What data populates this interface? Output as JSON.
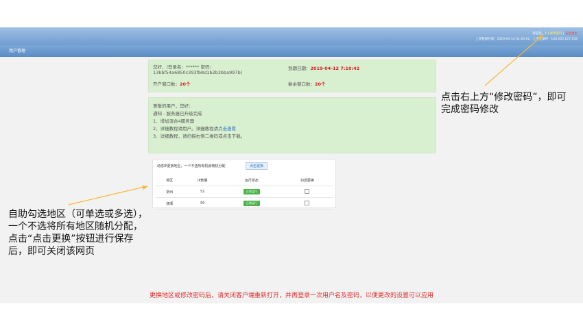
{
  "header": {
    "welcome_prefix": "欢迎您，",
    "username": "1",
    "change_password": "修改密码",
    "logout": "安全退出",
    "last_login_label": "上次登录时间：",
    "last_login_time": "2019-03-14 01:20:02",
    "last_login_ip_label": "上次登录IP：",
    "last_login_ip": "140.205.127.158"
  },
  "nav": {
    "title": "用户管理"
  },
  "account": {
    "greeting": "您好，(登录名：****** 密码：13bbf54a6850c393fb8d1b2b3bba997b)",
    "expire_label": "到期日期：",
    "expire_value": "2019-04-12 7:10:42",
    "open_windows_label": "开户窗口数：",
    "open_windows_value": "20个",
    "remaining_label": "剩余窗口数：",
    "remaining_value": "20个"
  },
  "notice": {
    "line1": "尊敬的用户，您好：",
    "line2": "通知 - 服务器已升级完成",
    "line3": "1、增加混合4服务器",
    "line4_prefix": "2、详细教程请用户。详细教程请",
    "line4_link": "点击查看",
    "line5": "3、详细教程，请扫描右侧二维码或点击下载。"
  },
  "panel": {
    "hint": "动态IP更换地区，一个不选所有机房随机分配",
    "change_button": "点击更换",
    "columns": [
      "地区",
      "IP数量",
      "运行状态",
      "勾选更换"
    ],
    "rows": [
      {
        "region": "常州",
        "count": "52",
        "status": "正常运行"
      },
      {
        "region": "抚顺",
        "count": "50",
        "status": "正常运行"
      }
    ]
  },
  "annotations": {
    "right": "点击右上方“修改密码”，即可完成密码修改",
    "left": "自助勾选地区（可单选或多选），一个不选将所有地区随机分配，点击“点击更换”按钮进行保存后，即可关闭该网页"
  },
  "footer": "更换地区或修改密码后，请关闭客户端重新打开，并再登录一次用户名及密码，以便更改的设置可以应用",
  "colors": {
    "header": "#7da8d8",
    "green_box": "#d9f0d0",
    "status": "#49b449",
    "footer_text": "#e03030",
    "arrow": "#f5b935"
  }
}
